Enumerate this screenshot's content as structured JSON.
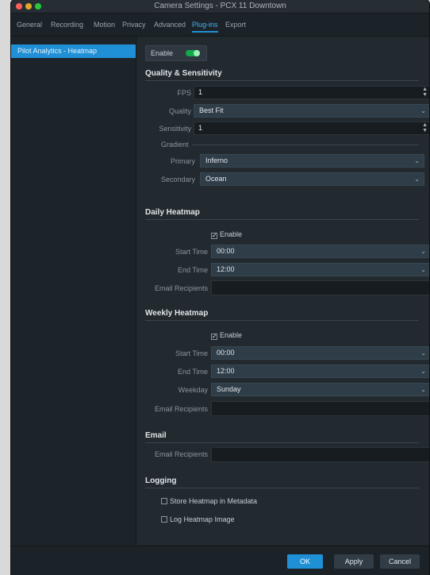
{
  "window": {
    "title": "Camera Settings - PCX 11 Downtown"
  },
  "tabs": [
    "General",
    "Recording",
    "Motion",
    "Privacy",
    "Advanced",
    "Plug-ins",
    "Export"
  ],
  "active_tab": "Plug-ins",
  "sidebar": {
    "items": [
      {
        "label": "Pilot Analytics - Heatmap",
        "selected": true
      }
    ]
  },
  "plugin": {
    "enable_label": "Enable",
    "enabled": true
  },
  "quality": {
    "title": "Quality & Sensitivity",
    "fps_label": "FPS",
    "fps_value": "1",
    "quality_label": "Quality",
    "quality_value": "Best Fit",
    "sensitivity_label": "Sensitivity",
    "sensitivity_value": "1",
    "gradient_title": "Gradient",
    "primary_label": "Primary",
    "primary_value": "Inferno",
    "secondary_label": "Secondary",
    "secondary_value": "Ocean"
  },
  "daily": {
    "title": "Daily Heatmap",
    "enable_label": "Enable",
    "enabled": true,
    "start_label": "Start Time",
    "start_value": "00:00",
    "end_label": "End Time",
    "end_value": "12:00",
    "email_label": "Email Recipients",
    "email_value": ""
  },
  "weekly": {
    "title": "Weekly Heatmap",
    "enable_label": "Enable",
    "enabled": true,
    "start_label": "Start Time",
    "start_value": "00:00",
    "end_label": "End Time",
    "end_value": "12:00",
    "weekday_label": "Weekday",
    "weekday_value": "Sunday",
    "email_label": "Email Recipients",
    "email_value": ""
  },
  "email": {
    "title": "Email",
    "recipients_label": "Email Recipients",
    "recipients_value": ""
  },
  "logging": {
    "title": "Logging",
    "store_label": "Store Heatmap in Metadata",
    "store_checked": false,
    "log_label": "Log Heatmap Image",
    "log_checked": false
  },
  "footer": {
    "ok": "OK",
    "apply": "Apply",
    "cancel": "Cancel"
  },
  "colors": {
    "accent": "#1f8fd6",
    "toggle_on": "#13a84b",
    "background": "#222a30"
  },
  "icons": {
    "checkbox_checked": "check-mark",
    "dropdown": "chevron-down",
    "spinner": "up-down-arrows"
  }
}
